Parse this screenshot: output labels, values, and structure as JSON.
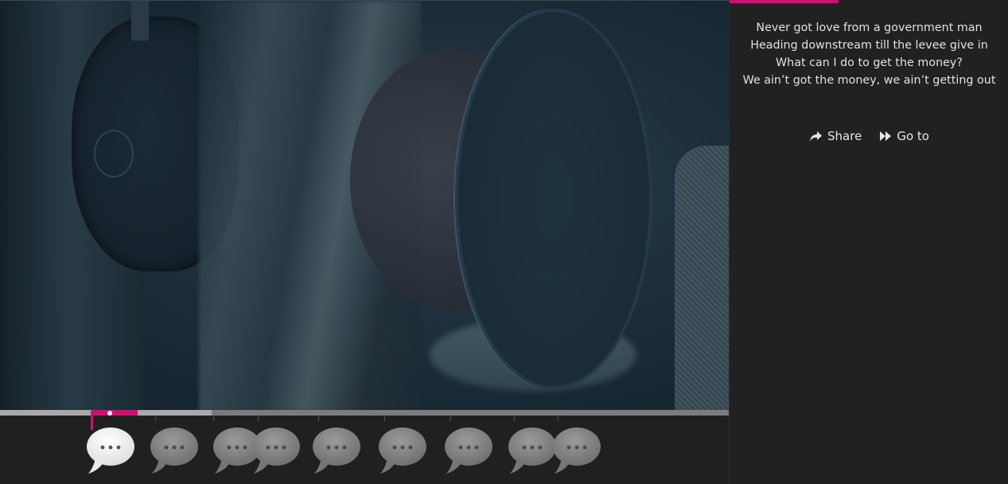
{
  "player": {
    "progress_percent": 14.5,
    "buffered_percent": 29
  },
  "lyrics": {
    "lines": [
      "Never got love from a government man",
      "Heading downstream till the levee give in",
      "What can I do to get the money?",
      "We ain’t got the money, we ain’t getting out"
    ],
    "panel_progress_fraction": 0.39
  },
  "actions": {
    "share_label": "Share",
    "share_icon": "share-arrow-icon",
    "goto_label": "Go to",
    "goto_icon": "fast-forward-icon"
  },
  "timeline": {
    "bubble_icon": "speech-bubble-ellipsis-icon",
    "bubbles": [
      {
        "active": true
      },
      {
        "active": false
      },
      {
        "active": false
      },
      {
        "active": false
      },
      {
        "active": false
      },
      {
        "active": false
      },
      {
        "active": false
      },
      {
        "active": false
      },
      {
        "active": false
      }
    ]
  },
  "colors": {
    "accent": "#c7156f",
    "panel_bg": "#212121",
    "lyrics_text": "#e1e1e1",
    "bubble_active": "#ffffff",
    "bubble_inactive": "#8a8a8a"
  }
}
